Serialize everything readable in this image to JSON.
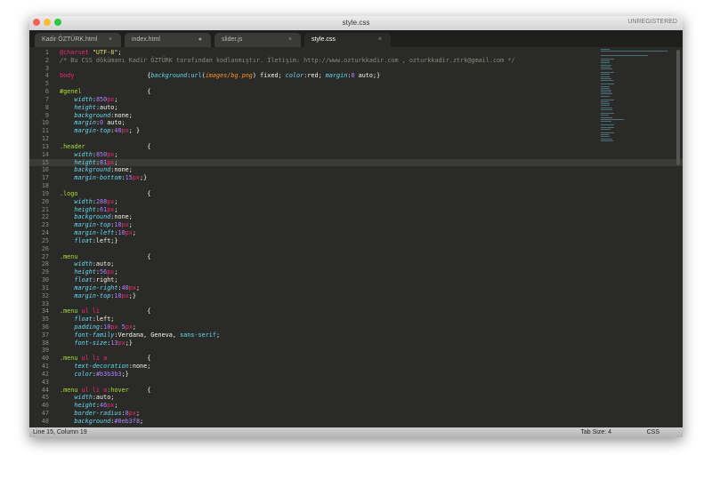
{
  "window": {
    "title": "style.css",
    "unregistered": "UNREGISTERED"
  },
  "tabs": [
    {
      "label": "Kadir ÖZTÜRK.html",
      "mark": "×"
    },
    {
      "label": "index.html",
      "mark": "●"
    },
    {
      "label": "slider.js",
      "mark": "×"
    },
    {
      "label": "style.css",
      "mark": "×"
    }
  ],
  "status": {
    "position": "Line 15, Column 19",
    "tab_size": "Tab Size: 4",
    "syntax": "CSS"
  },
  "current_line": 15,
  "lines": [
    [
      [
        "k",
        "@charset"
      ],
      [
        "v",
        " "
      ],
      [
        "s",
        "\"UTF-8\""
      ],
      [
        "v",
        ";"
      ]
    ],
    [
      [
        "c",
        "/* Bu CSS dökümanı Kadir ÖZTÜRK tarafından kodlanmıştır. İletişim: http://www.ozturkkadir.com , ozturkkadir.ztrk@gmail.com */"
      ]
    ],
    [],
    [
      [
        "t",
        "body"
      ],
      [
        "v",
        "                    {"
      ],
      [
        "p",
        "background"
      ],
      [
        "v",
        ":"
      ],
      [
        "f",
        "url"
      ],
      [
        "v",
        "("
      ],
      [
        "o",
        "images/bg.png"
      ],
      [
        "v",
        ") fixed; "
      ],
      [
        "p",
        "color"
      ],
      [
        "v",
        ":red; "
      ],
      [
        "p",
        "margin"
      ],
      [
        "v",
        ":"
      ],
      [
        "n",
        "0"
      ],
      [
        "v",
        " auto;}"
      ]
    ],
    [],
    [
      [
        "sel",
        "#genel"
      ],
      [
        "v",
        "                  {"
      ]
    ],
    [
      [
        "v",
        "    "
      ],
      [
        "p",
        "width"
      ],
      [
        "v",
        ":"
      ],
      [
        "n",
        "850"
      ],
      [
        "u",
        "px"
      ],
      [
        "v",
        ";"
      ]
    ],
    [
      [
        "v",
        "    "
      ],
      [
        "p",
        "height"
      ],
      [
        "v",
        ":auto;"
      ]
    ],
    [
      [
        "v",
        "    "
      ],
      [
        "p",
        "background"
      ],
      [
        "v",
        ":none;"
      ]
    ],
    [
      [
        "v",
        "    "
      ],
      [
        "p",
        "margin"
      ],
      [
        "v",
        ":"
      ],
      [
        "n",
        "0"
      ],
      [
        "v",
        " auto;"
      ]
    ],
    [
      [
        "v",
        "    "
      ],
      [
        "p",
        "margin-top"
      ],
      [
        "v",
        ":"
      ],
      [
        "n",
        "40"
      ],
      [
        "u",
        "px"
      ],
      [
        "v",
        "; }"
      ]
    ],
    [],
    [
      [
        "sel",
        ".header"
      ],
      [
        "v",
        "                 {"
      ]
    ],
    [
      [
        "v",
        "    "
      ],
      [
        "p",
        "width"
      ],
      [
        "v",
        ":"
      ],
      [
        "n",
        "850"
      ],
      [
        "u",
        "px"
      ],
      [
        "v",
        ";"
      ]
    ],
    [
      [
        "v",
        "    "
      ],
      [
        "p",
        "height"
      ],
      [
        "v",
        ":"
      ],
      [
        "n",
        "81"
      ],
      [
        "u",
        "px"
      ],
      [
        "v",
        ";"
      ]
    ],
    [
      [
        "v",
        "    "
      ],
      [
        "p",
        "background"
      ],
      [
        "v",
        ":none;"
      ]
    ],
    [
      [
        "v",
        "    "
      ],
      [
        "p",
        "margin-bottom"
      ],
      [
        "v",
        ":"
      ],
      [
        "n",
        "15"
      ],
      [
        "u",
        "px"
      ],
      [
        "v",
        ";}"
      ]
    ],
    [],
    [
      [
        "sel",
        ".logo"
      ],
      [
        "v",
        "                   {"
      ]
    ],
    [
      [
        "v",
        "    "
      ],
      [
        "p",
        "width"
      ],
      [
        "v",
        ":"
      ],
      [
        "n",
        "288"
      ],
      [
        "u",
        "px"
      ],
      [
        "v",
        ";"
      ]
    ],
    [
      [
        "v",
        "    "
      ],
      [
        "p",
        "height"
      ],
      [
        "v",
        ":"
      ],
      [
        "n",
        "61"
      ],
      [
        "u",
        "px"
      ],
      [
        "v",
        ";"
      ]
    ],
    [
      [
        "v",
        "    "
      ],
      [
        "p",
        "background"
      ],
      [
        "v",
        ":none;"
      ]
    ],
    [
      [
        "v",
        "    "
      ],
      [
        "p",
        "margin-top"
      ],
      [
        "v",
        ":"
      ],
      [
        "n",
        "10"
      ],
      [
        "u",
        "px"
      ],
      [
        "v",
        ";"
      ]
    ],
    [
      [
        "v",
        "    "
      ],
      [
        "p",
        "margin-left"
      ],
      [
        "v",
        ":"
      ],
      [
        "n",
        "10"
      ],
      [
        "u",
        "px"
      ],
      [
        "v",
        ";"
      ]
    ],
    [
      [
        "v",
        "    "
      ],
      [
        "p",
        "float"
      ],
      [
        "v",
        ":left;}"
      ]
    ],
    [],
    [
      [
        "sel",
        ".menu"
      ],
      [
        "v",
        "                   {"
      ]
    ],
    [
      [
        "v",
        "    "
      ],
      [
        "p",
        "width"
      ],
      [
        "v",
        ":auto;"
      ]
    ],
    [
      [
        "v",
        "    "
      ],
      [
        "p",
        "height"
      ],
      [
        "v",
        ":"
      ],
      [
        "n",
        "56"
      ],
      [
        "u",
        "px"
      ],
      [
        "v",
        ";"
      ]
    ],
    [
      [
        "v",
        "    "
      ],
      [
        "p",
        "float"
      ],
      [
        "v",
        ":right;"
      ]
    ],
    [
      [
        "v",
        "    "
      ],
      [
        "p",
        "margin-right"
      ],
      [
        "v",
        ":"
      ],
      [
        "n",
        "40"
      ],
      [
        "u",
        "px"
      ],
      [
        "v",
        ";"
      ]
    ],
    [
      [
        "v",
        "    "
      ],
      [
        "p",
        "margin-top"
      ],
      [
        "v",
        ":"
      ],
      [
        "n",
        "10"
      ],
      [
        "u",
        "px"
      ],
      [
        "v",
        ";}"
      ]
    ],
    [],
    [
      [
        "sel",
        ".menu"
      ],
      [
        "v",
        " "
      ],
      [
        "t",
        "ul li"
      ],
      [
        "v",
        "             {"
      ]
    ],
    [
      [
        "v",
        "    "
      ],
      [
        "p",
        "float"
      ],
      [
        "v",
        ":left;"
      ]
    ],
    [
      [
        "v",
        "    "
      ],
      [
        "p",
        "padding"
      ],
      [
        "v",
        ":"
      ],
      [
        "n",
        "10"
      ],
      [
        "u",
        "px"
      ],
      [
        "v",
        " "
      ],
      [
        "n",
        "5"
      ],
      [
        "u",
        "px"
      ],
      [
        "v",
        ";"
      ]
    ],
    [
      [
        "v",
        "    "
      ],
      [
        "p",
        "font-family"
      ],
      [
        "v",
        ":Verdana, Geneva, "
      ],
      [
        "f",
        "sans-serif"
      ],
      [
        "v",
        ";"
      ]
    ],
    [
      [
        "v",
        "    "
      ],
      [
        "p",
        "font-size"
      ],
      [
        "v",
        ":"
      ],
      [
        "n",
        "13"
      ],
      [
        "u",
        "px"
      ],
      [
        "v",
        ";}"
      ]
    ],
    [],
    [
      [
        "sel",
        ".menu"
      ],
      [
        "v",
        " "
      ],
      [
        "t",
        "ul li a"
      ],
      [
        "v",
        "           {"
      ]
    ],
    [
      [
        "v",
        "    "
      ],
      [
        "p",
        "text-decoration"
      ],
      [
        "v",
        ":none;"
      ]
    ],
    [
      [
        "v",
        "    "
      ],
      [
        "p",
        "color"
      ],
      [
        "v",
        ":"
      ],
      [
        "n",
        "#b3b3b3"
      ],
      [
        "v",
        ";}"
      ]
    ],
    [],
    [
      [
        "sel",
        ".menu"
      ],
      [
        "v",
        " "
      ],
      [
        "t",
        "ul li a"
      ],
      [
        "sel",
        ":hover"
      ],
      [
        "v",
        "     {"
      ]
    ],
    [
      [
        "v",
        "    "
      ],
      [
        "p",
        "width"
      ],
      [
        "v",
        ":auto;"
      ]
    ],
    [
      [
        "v",
        "    "
      ],
      [
        "p",
        "height"
      ],
      [
        "v",
        ":"
      ],
      [
        "n",
        "46"
      ],
      [
        "u",
        "px"
      ],
      [
        "v",
        ";"
      ]
    ],
    [
      [
        "v",
        "    "
      ],
      [
        "p",
        "border-radius"
      ],
      [
        "v",
        ":"
      ],
      [
        "n",
        "8"
      ],
      [
        "u",
        "px"
      ],
      [
        "v",
        ";"
      ]
    ],
    [
      [
        "v",
        "    "
      ],
      [
        "p",
        "background"
      ],
      [
        "v",
        ":"
      ],
      [
        "n",
        "#0eb3f8"
      ],
      [
        "v",
        ";"
      ]
    ]
  ]
}
